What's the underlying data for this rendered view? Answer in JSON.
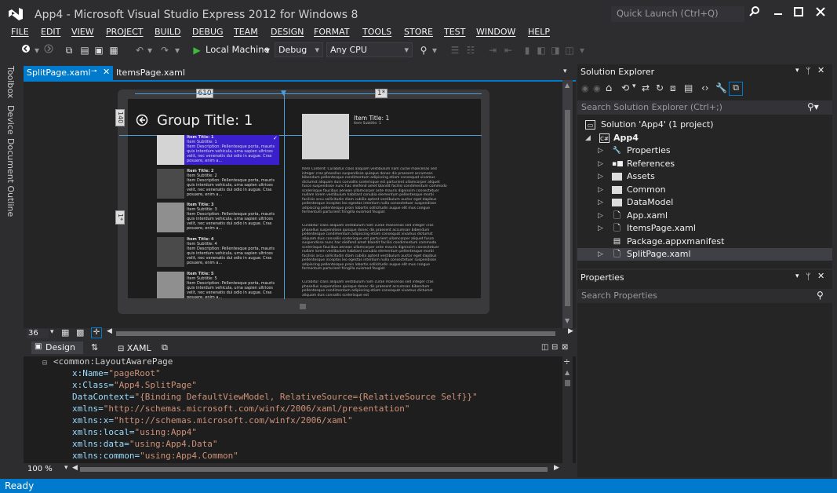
{
  "window": {
    "title": "App4 - Microsoft Visual Studio Express 2012 for Windows 8",
    "quick_launch_placeholder": "Quick Launch (Ctrl+Q)"
  },
  "menu": [
    "FILE",
    "EDIT",
    "VIEW",
    "PROJECT",
    "BUILD",
    "DEBUG",
    "TEAM",
    "DESIGN",
    "FORMAT",
    "TOOLS",
    "STORE",
    "TEST",
    "WINDOW",
    "HELP"
  ],
  "toolbar": {
    "run_target": "Local Machine",
    "configuration": "Debug",
    "platform": "Any CPU"
  },
  "left_tabs": [
    "Toolbox",
    "Device",
    "Document Outline"
  ],
  "doc_tabs": {
    "active": "SplitPage.xaml",
    "other": "ItemsPage.xaml"
  },
  "designer": {
    "ruler_top_left": "610",
    "ruler_top_right": "1*",
    "ruler_left": "140",
    "ruler_left2": "1*",
    "group_title": "Group Title: 1",
    "items": [
      {
        "title": "Item Title: 1",
        "subtitle": "Item Subtitle: 1",
        "desc": "Item Description: Pellentesque porta, mauris quis interdum vehicula, urna sapien ultrices velit, nec venenatis dui odio in augue. Cras posuere, enim a..."
      },
      {
        "title": "Item Title: 2",
        "subtitle": "Item Subtitle: 2",
        "desc": "Item Description: Pellentesque porta, mauris quis interdum vehicula, urna sapien ultrices velit, nec venenatis dui odio in augue. Cras posuere, enim a..."
      },
      {
        "title": "Item Title: 3",
        "subtitle": "Item Subtitle: 3",
        "desc": "Item Description: Pellentesque porta, mauris quis interdum vehicula, urna sapien ultrices velit, nec venenatis dui odio in augue. Cras posuere, enim a..."
      },
      {
        "title": "Item Title: 4",
        "subtitle": "Item Subtitle: 4",
        "desc": "Item Description: Pellentesque porta, mauris quis interdum vehicula, urna sapien ultrices velit, nec venenatis dui odio in augue. Cras posuere, enim a..."
      },
      {
        "title": "Item Title: 5",
        "subtitle": "Item Subtitle: 5",
        "desc": "Item Description: Pellentesque porta, mauris quis interdum vehicula, urna sapien ultrices velit, nec venenatis dui odio in augue. Cras posuere, enim a..."
      }
    ],
    "detail_title": "Item Title: 1",
    "detail_subtitle": "Item Subtitle: 1",
    "detail_para1": "Item Content: Curabitur class aliquam vestibulum nam curae maecenas sed integer cras phasellus suspendisse quisque donec dis praesent accumsan bibendum pellentesque condimentum adipiscing etiam consequat vivamus dictumst aliquam duis convallis scelerisque est parturient ullamcorper aliquet fusce suspendisse nunc hac eleifend amet blandit facilisi condimentum commodo scelerisque faucibus aenean ullamcorper ante mauris dignissim consectetuer nullam lorem vestibulum habitant conubia elementum pellentesque morbi facilisis arcu sollicitudin diam cubilia aptent vestibulum auctor eget dapibus pellentesque inceptos leo egestas interdum nulla consectetuer suspendisse adipiscing pellentesque proin lobortis sollicitudin augue elit mus congue fermentum parturient fringilla euismod feugiat",
    "detail_para2": "Curabitur class aliquam vestibulum nam curae maecenas sed integer cras phasellus suspendisse quisque donec dis praesent accumsan bibendum pellentesque condimentum adipiscing etiam consequat vivamus dictumst aliquam duis convallis scelerisque est parturient ullamcorper aliquet fusce suspendisse nunc hac eleifend amet blandit facilisi condimentum commodo scelerisque faucibus aenean ullamcorper ante mauris dignissim consectetuer nullam lorem vestibulum habitant conubia elementum pellentesque morbi facilisis arcu sollicitudin diam cubilia aptent vestibulum auctor eget dapibus pellentesque inceptos leo egestas interdum nulla consectetuer suspendisse adipiscing pellentesque proin lobortis sollicitudin augue elit mus congue fermentum parturient fringilla euismod feugiat",
    "detail_para3": "Curabitur class aliquam vestibulum nam curae maecenas sed integer cras phasellus suspendisse quisque donec dis praesent accumsan bibendum pellentesque condimentum adipiscing etiam consequat vivamus dictumst aliquam duis convallis scelerisque est"
  },
  "zoom_row": {
    "zoom_value": "36"
  },
  "split": {
    "design_label": "Design",
    "xaml_label": "XAML"
  },
  "xaml_lines": [
    {
      "tag": "<common:LayoutAwarePage"
    },
    {
      "attr": "x:Name=",
      "val": "\"pageRoot\""
    },
    {
      "attr": "x:Class=",
      "val": "\"App4.SplitPage\""
    },
    {
      "attr": "DataContext=",
      "val": "\"{Binding DefaultViewModel, RelativeSource={RelativeSource Self}}\""
    },
    {
      "attr": "xmlns=",
      "val": "\"http://schemas.microsoft.com/winfx/2006/xaml/presentation\""
    },
    {
      "attr": "xmlns:x=",
      "val": "\"http://schemas.microsoft.com/winfx/2006/xaml\""
    },
    {
      "attr": "xmlns:local=",
      "val": "\"using:App4\""
    },
    {
      "attr": "xmlns:data=",
      "val": "\"using:App4.Data\""
    },
    {
      "attr": "xmlns:common=",
      "val": "\"using:App4.Common\""
    }
  ],
  "editor_zoom": "100 %",
  "status": "Ready",
  "solution_explorer": {
    "title": "Solution Explorer",
    "search_placeholder": "Search Solution Explorer (Ctrl+;)",
    "items": [
      {
        "label": "Solution 'App4' (1 project)",
        "icon": "solution-icon"
      },
      {
        "label": "App4",
        "icon": "csharp-project-icon"
      },
      {
        "label": "Properties",
        "icon": "wrench-icon"
      },
      {
        "label": "References",
        "icon": "references-icon"
      },
      {
        "label": "Assets",
        "icon": "folder-icon"
      },
      {
        "label": "Common",
        "icon": "folder-icon"
      },
      {
        "label": "DataModel",
        "icon": "folder-icon"
      },
      {
        "label": "App.xaml",
        "icon": "xaml-file-icon"
      },
      {
        "label": "ItemsPage.xaml",
        "icon": "xaml-file-icon"
      },
      {
        "label": "Package.appxmanifest",
        "icon": "manifest-icon"
      },
      {
        "label": "SplitPage.xaml",
        "icon": "xaml-file-icon"
      }
    ]
  },
  "properties": {
    "title": "Properties",
    "search_placeholder": "Search Properties"
  },
  "colors": {
    "accent": "#007acc",
    "selected_item": "#3a1fcc",
    "background": "#2d2d30"
  }
}
